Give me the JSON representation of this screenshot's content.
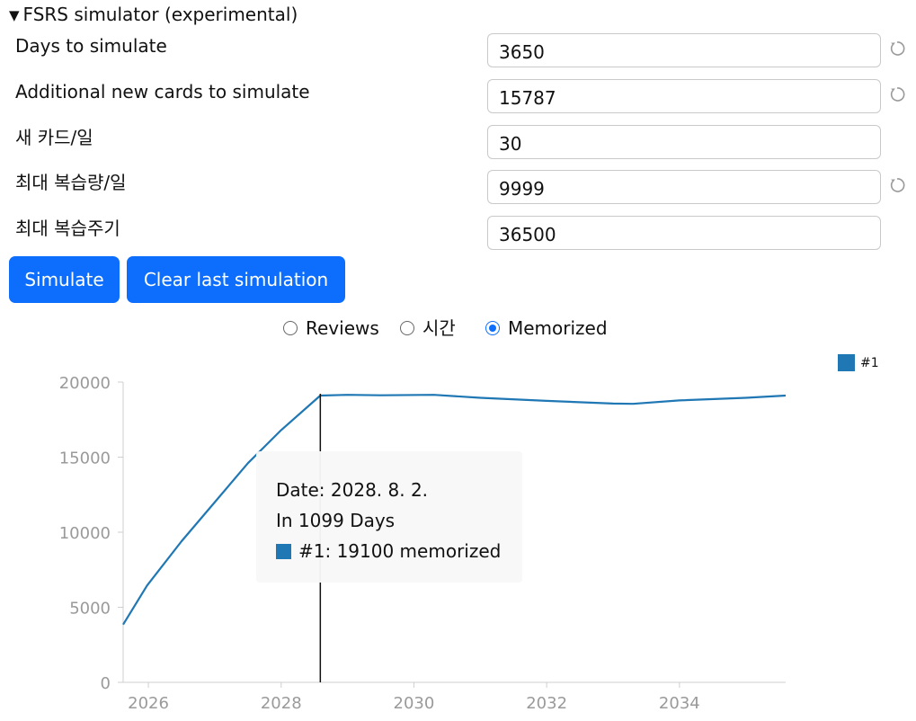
{
  "panel": {
    "title": "FSRS simulator (experimental)"
  },
  "fields": [
    {
      "label": "Days to simulate",
      "value": "3650",
      "revertable": true
    },
    {
      "label": "Additional new cards to simulate",
      "value": "15787",
      "revertable": true
    },
    {
      "label": "새 카드/일",
      "value": "30",
      "revertable": false
    },
    {
      "label": "최대 복습량/일",
      "value": "9999",
      "revertable": true
    },
    {
      "label": "최대 복습주기",
      "value": "36500",
      "revertable": false
    }
  ],
  "buttons": {
    "simulate": "Simulate",
    "clear": "Clear last simulation"
  },
  "mode_options": [
    {
      "label": "Reviews",
      "checked": false
    },
    {
      "label": "시간",
      "checked": false
    },
    {
      "label": "Memorized",
      "checked": true
    }
  ],
  "tooltip": {
    "date": "Date: 2028. 8. 2.",
    "days": "In 1099 Days",
    "series": "#1: 19100 memorized"
  },
  "colors": {
    "accent": "#0d6efd",
    "series": "#1f77b4"
  },
  "chart_data": {
    "type": "line",
    "x_unit": "year",
    "xlim": [
      2025.62,
      2035.6
    ],
    "ylim": [
      0,
      20000
    ],
    "y_ticks": [
      0,
      5000,
      10000,
      15000,
      20000
    ],
    "x_ticks": [
      2026,
      2028,
      2030,
      2032,
      2034
    ],
    "grid": false,
    "legend": "top-right",
    "cursor_x": 2028.59,
    "series": [
      {
        "name": "#1",
        "color": "#1f77b4",
        "x": [
          2025.62,
          2025.98,
          2026.5,
          2027.0,
          2027.5,
          2028.0,
          2028.59,
          2029.0,
          2029.5,
          2030.3,
          2031.0,
          2032.0,
          2033.0,
          2033.3,
          2034.0,
          2035.0,
          2035.6
        ],
        "y": [
          3850,
          6450,
          9400,
          12000,
          14600,
          16800,
          19100,
          19150,
          19120,
          19150,
          18950,
          18750,
          18570,
          18550,
          18780,
          18950,
          19100
        ]
      }
    ]
  }
}
